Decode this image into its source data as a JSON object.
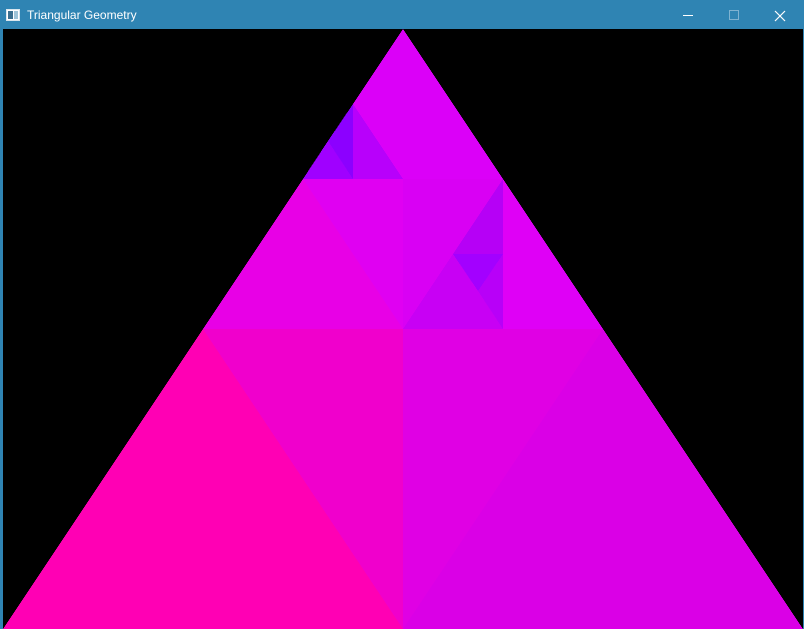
{
  "window": {
    "title": "Triangular Geometry",
    "controls": {
      "minimize_icon": "minimize-icon",
      "maximize_icon": "maximize-icon",
      "close_icon": "close-icon"
    }
  },
  "colors": {
    "titlebar": "#2f84b3",
    "background": "#000000",
    "hot_pink": "#ff00b4",
    "magenta": "#db00e8",
    "violet": "#e000ff",
    "purple": "#a300ff",
    "deep_purple": "#8c00ff"
  }
}
